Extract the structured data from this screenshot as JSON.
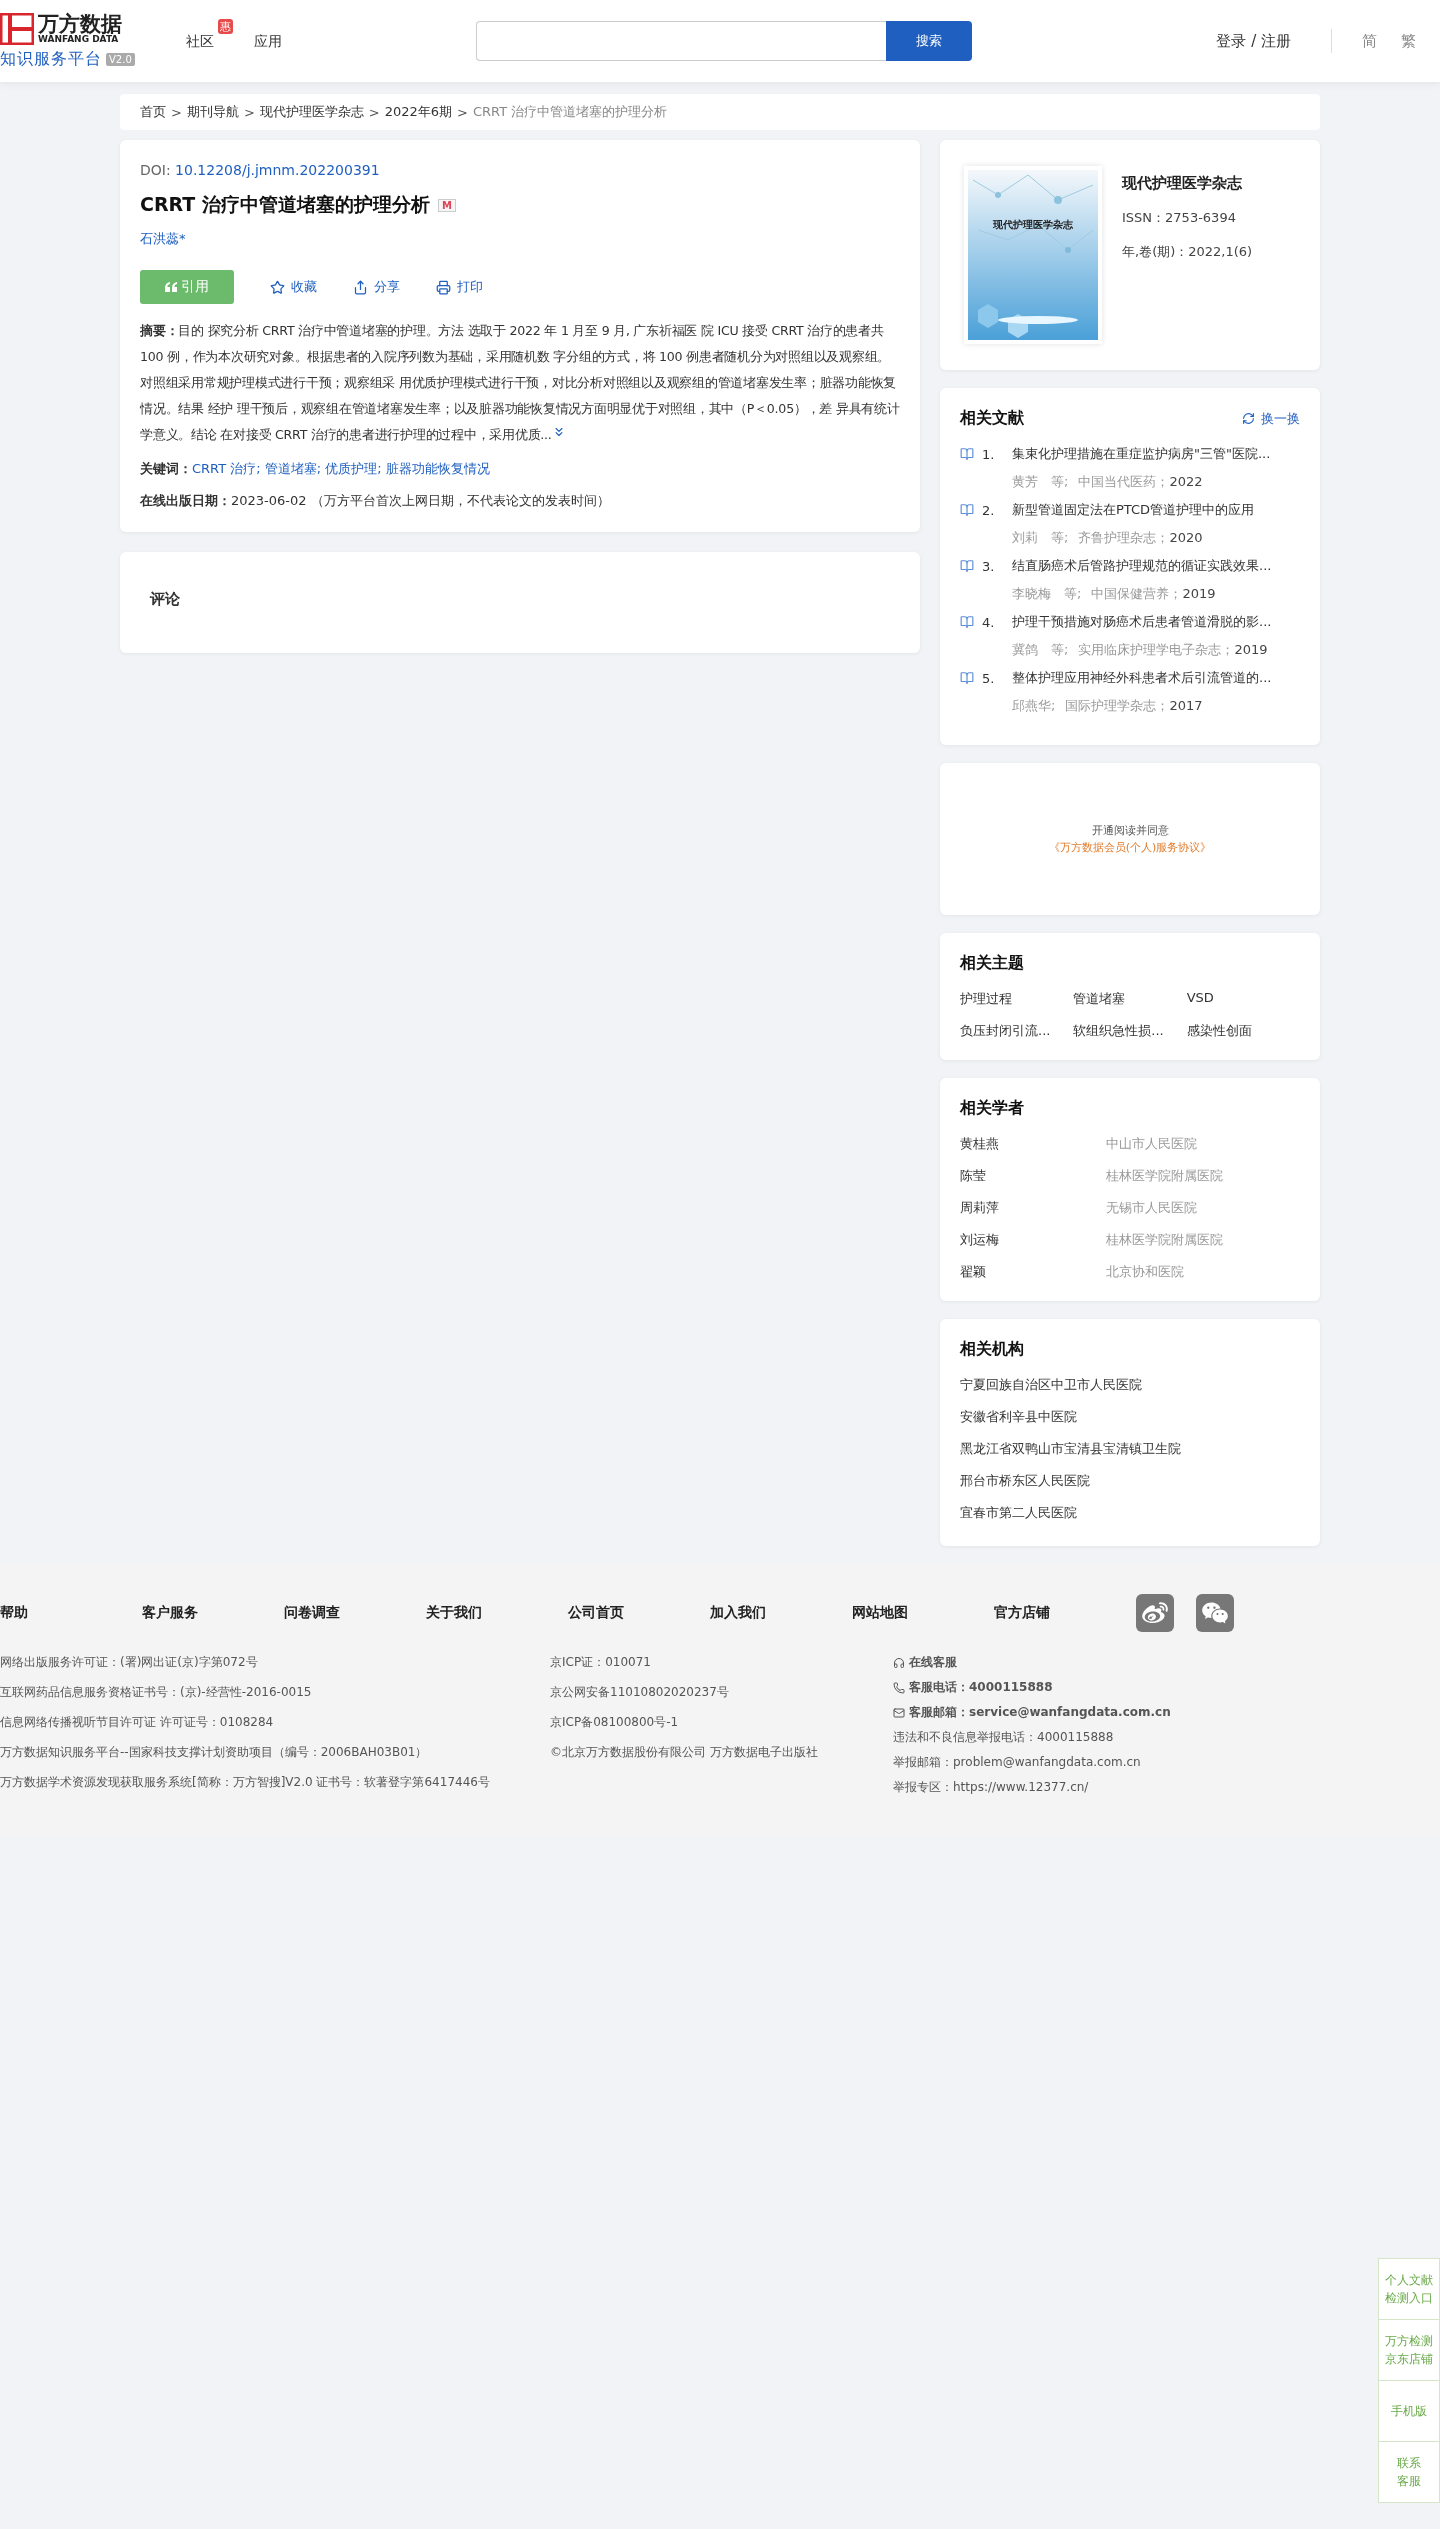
{
  "header": {
    "logo": {
      "brand": "万方数据",
      "brand_en": "WANFANG DATA",
      "platform": "知识服务平台",
      "version": "V2.0"
    },
    "nav": [
      {
        "label": "社区",
        "badge": "惠"
      },
      {
        "label": "应用"
      }
    ],
    "search": {
      "button": "搜索"
    },
    "login": "登录 / 注册",
    "languages": [
      "简",
      "繁"
    ]
  },
  "breadcrumb_separator": ">",
  "breadcrumb": [
    "首页",
    "期刊导航",
    "现代护理医学杂志",
    "2022年6期",
    "CRRT 治疗中管道堵塞的护理分析"
  ],
  "article": {
    "doi_label": "DOI:",
    "doi": "10.12208/j.jmnm.202200391",
    "title": "CRRT 治疗中管道堵塞的护理分析",
    "badge": "M",
    "author": "石洪蕊*",
    "actions": [
      {
        "kind": "cite",
        "label": "引用"
      },
      {
        "kind": "favorite",
        "label": "收藏"
      },
      {
        "kind": "share",
        "label": "分享"
      },
      {
        "kind": "print",
        "label": "打印"
      }
    ],
    "abstract": {
      "label": "摘要：",
      "text": "目的 探究分析 CRRT 治疗中管道堵塞的护理。方法 选取于 2022 年 1 月至 9 月, 广东祈福医 院 ICU 接受 CRRT 治疗的患者共 100 例，作为本次研究对象。根据患者的入院序列数为基础，采用随机数 字分组的方式，将 100 例患者随机分为对照组以及观察组。对照组采用常规护理模式进行干预；观察组采 用优质护理模式进行干预，对比分析对照组以及观察组的管道堵塞发生率；脏器功能恢复情况。结果 经护 理干预后，观察组在管道堵塞发生率；以及脏器功能恢复情况方面明显优于对照组，其中（P＜0.05），差 异具有统计学意义。结论 在对接受 CRRT 治疗的患者进行护理的过程中，采用优质..."
    },
    "keywords": {
      "label": "关键词：",
      "separator": ";",
      "items": [
        "CRRT 治疗",
        "管道堵塞",
        "优质护理",
        "脏器功能恢复情况"
      ]
    },
    "online_date": {
      "label": "在线出版日期：",
      "value": "2023-06-02",
      "note": "（万方平台首次上网日期，不代表论文的发表时间）"
    }
  },
  "comments": {
    "title": "评论"
  },
  "journal": {
    "cover_title": "现代护理医学杂志",
    "name": "现代护理医学杂志",
    "issn": "ISSN：2753-6394",
    "issue": "年,卷(期)：2022,1(6)"
  },
  "related_papers": {
    "title": "相关文献",
    "refresh": "换一换",
    "items": [
      {
        "num": "1.",
        "title": "集束化护理措施在重症监护病房\"三管\"医院...",
        "authors": "黄芳　等;",
        "source": "中国当代医药；",
        "year": "2022"
      },
      {
        "num": "2.",
        "title": "新型管道固定法在PTCD管道护理中的应用",
        "authors": "刘莉　等;",
        "source": "齐鲁护理杂志；",
        "year": "2020"
      },
      {
        "num": "3.",
        "title": "结直肠癌术后管路护理规范的循证实践效果...",
        "authors": "李晓梅　等;",
        "source": "中国保健营养；",
        "year": "2019"
      },
      {
        "num": "4.",
        "title": "护理干预措施对肠癌术后患者管道滑脱的影...",
        "authors": "冀鸽　等;",
        "source": "实用临床护理学电子杂志；",
        "year": "2019"
      },
      {
        "num": "5.",
        "title": "整体护理应用神经外科患者术后引流管道的...",
        "authors": "邱燕华;",
        "source": "国际护理学杂志；",
        "year": "2017"
      }
    ]
  },
  "membership": {
    "text": "开通阅读并同意",
    "link": "《万方数据会员(个人)服务协议》"
  },
  "topics": {
    "title": "相关主题",
    "items": [
      "护理过程",
      "管道堵塞",
      "VSD",
      "负压封闭引流...",
      "软组织急性损...",
      "感染性创面"
    ]
  },
  "scholars": {
    "title": "相关学者",
    "items": [
      {
        "name": "黄桂燕",
        "org": "中山市人民医院"
      },
      {
        "name": "陈莹",
        "org": "桂林医学院附属医院"
      },
      {
        "name": "周莉萍",
        "org": "无锡市人民医院"
      },
      {
        "name": "刘运梅",
        "org": "桂林医学院附属医院"
      },
      {
        "name": "翟颖",
        "org": "北京协和医院"
      }
    ]
  },
  "institutions": {
    "title": "相关机构",
    "items": [
      "宁夏回族自治区中卫市人民医院",
      "安徽省利辛县中医院",
      "黑龙江省双鸭山市宝清县宝清镇卫生院",
      "邢台市桥东区人民医院",
      "宜春市第二人民医院"
    ]
  },
  "footer": {
    "links": [
      "帮助",
      "客户服务",
      "问卷调查",
      "关于我们",
      "公司首页",
      "加入我们",
      "网站地图",
      "官方店铺"
    ],
    "social": [
      {
        "kind": "weibo"
      },
      {
        "kind": "wechat"
      }
    ],
    "column_1": [
      "网络出版服务许可证：(署)网出证(京)字第072号",
      "互联网药品信息服务资格证书号：(京)-经营性-2016-0015",
      "信息网络传播视听节目许可证 许可证号：0108284",
      "万方数据知识服务平台--国家科技支撑计划资助项目（编号：2006BAH03B01）",
      "万方数据学术资源发现获取服务系统[简称：万方智搜]V2.0 证书号：软著登字第6417446号"
    ],
    "column_2": [
      "京ICP证：010071",
      "京公网安备11010802020237号",
      "京ICP备08100800号-1",
      "©北京万方数据股份有限公司 万方数据电子出版社"
    ],
    "column_3": [
      {
        "kind": "headset",
        "text": "在线客服"
      },
      {
        "kind": "phone",
        "text": "客服电话：4000115888"
      },
      {
        "kind": "mail",
        "text": "客服邮箱：service@wanfangdata.com.cn"
      },
      {
        "kind": "plain",
        "text": "违法和不良信息举报电话：4000115888"
      },
      {
        "kind": "plain",
        "text": "举报邮箱：problem@wanfangdata.com.cn"
      },
      {
        "kind": "plain",
        "text": "举报专区：https://www.12377.cn/"
      }
    ]
  },
  "side_bar": [
    [
      "个人文献",
      "检测入口"
    ],
    [
      "万方检测",
      "京东店铺"
    ],
    [
      "手机版"
    ],
    [
      "联系",
      "客服"
    ]
  ]
}
